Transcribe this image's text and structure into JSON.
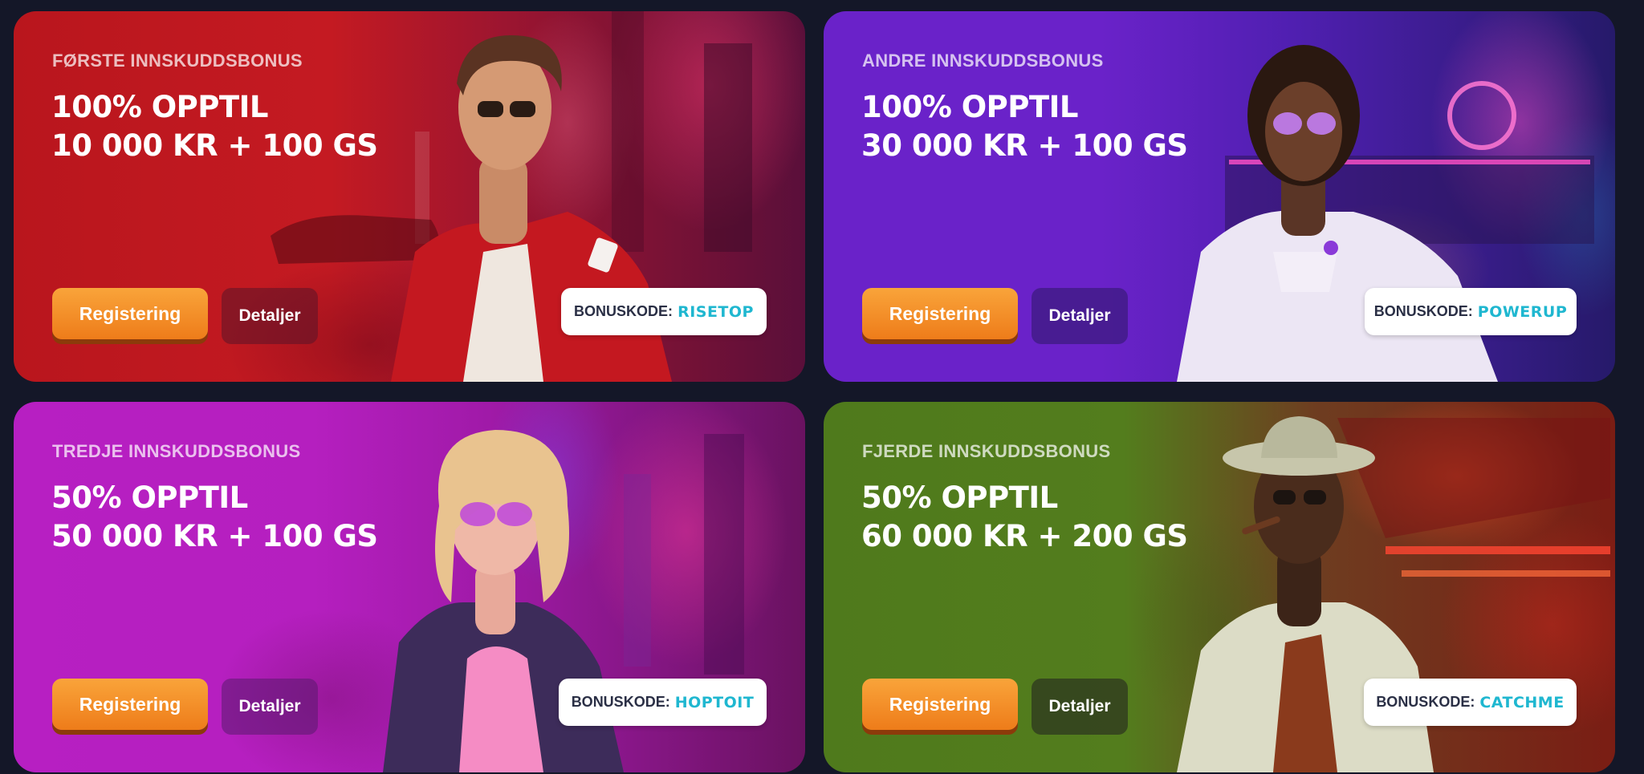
{
  "cards": [
    {
      "eyebrow": "FØRSTE INNSKUDDSBONUS",
      "headline_line1": "100% OPPTIL",
      "headline_line2": "10 000 KR + 100 GS",
      "register_label": "Registering",
      "details_label": "Detaljer",
      "bonus_label": "BONUSKODE:",
      "bonus_code": "RISETOP",
      "theme_color": "#c4181f"
    },
    {
      "eyebrow": "ANDRE INNSKUDDSBONUS",
      "headline_line1": "100% OPPTIL",
      "headline_line2": "30 000 KR + 100 GS",
      "register_label": "Registering",
      "details_label": "Detaljer",
      "bonus_label": "BONUSKODE:",
      "bonus_code": "POWERUP",
      "theme_color": "#6a22c9"
    },
    {
      "eyebrow": "TREDJE INNSKUDDSBONUS",
      "headline_line1": "50% OPPTIL",
      "headline_line2": "50 000 KR + 100 GS",
      "register_label": "Registering",
      "details_label": "Detaljer",
      "bonus_label": "BONUSKODE:",
      "bonus_code": "HOPTOIT",
      "theme_color": "#b41fc0"
    },
    {
      "eyebrow": "FJERDE INNSKUDDSBONUS",
      "headline_line1": "50% OPPTIL",
      "headline_line2": "60 000 KR + 200 GS",
      "register_label": "Registering",
      "details_label": "Detaljer",
      "bonus_label": "BONUSKODE:",
      "bonus_code": "CATCHME",
      "theme_color": "#4f7a1c"
    }
  ],
  "colors": {
    "page_background": "#141728",
    "register_button": "#f29128",
    "bonus_code_text": "#1fb7d0"
  }
}
